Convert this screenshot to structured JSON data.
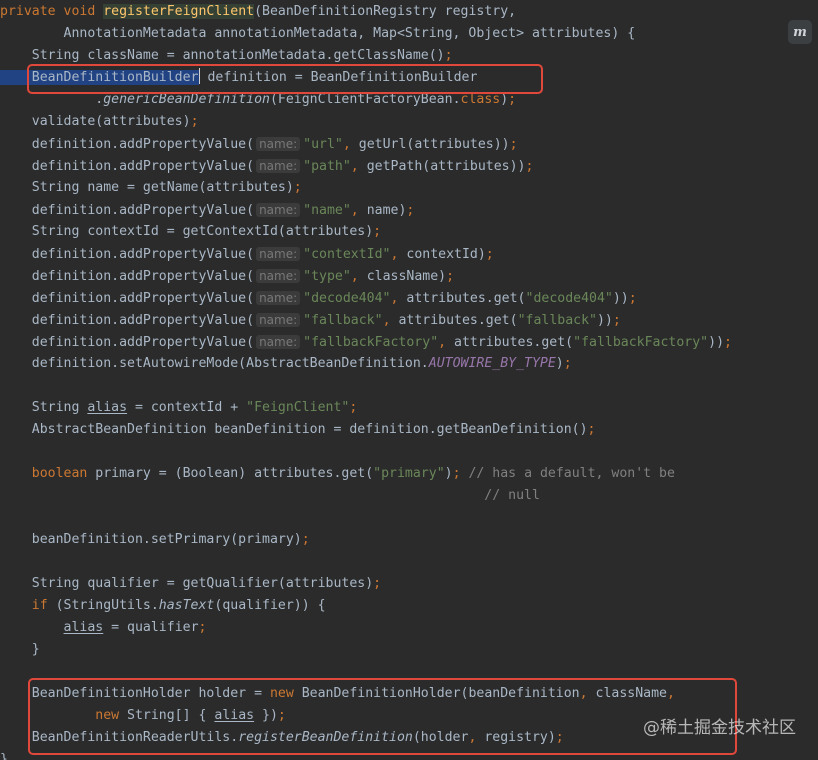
{
  "editor": {
    "plugin_badge": "m",
    "watermark": "@稀土掘金技术社区",
    "lines": [
      [
        [
          "kw",
          "private void "
        ],
        [
          "fnbg",
          "registerFeignClient"
        ],
        [
          "",
          "(BeanDefinitionRegistry registry,"
        ]
      ],
      [
        [
          "",
          "        AnnotationMetadata annotationMetadata, Map<String, Object> attributes) {"
        ]
      ],
      [
        [
          "",
          "    String className = annotationMetadata.getClassName()"
        ],
        [
          "kw",
          ";"
        ]
      ],
      [
        [
          "sel",
          "    BeanDefinitionBuilder"
        ],
        [
          "caret",
          ""
        ],
        [
          "sel",
          ""
        ],
        [
          "",
          " definition = BeanDefinitionBuilder"
        ]
      ],
      [
        [
          "",
          "            ."
        ],
        [
          "it",
          "genericBeanDefinition"
        ],
        [
          "",
          "(FeignClientFactoryBean."
        ],
        [
          "kw",
          "class"
        ],
        [
          "",
          ")"
        ],
        [
          "kw",
          ";"
        ]
      ],
      [
        [
          "",
          "    validate(attributes)"
        ],
        [
          "kw",
          ";"
        ]
      ],
      [
        [
          "",
          "    definition.addPropertyValue("
        ],
        [
          "hint",
          "name:"
        ],
        [
          "str",
          "\"url\""
        ],
        [
          "kw",
          ","
        ],
        [
          "",
          " getUrl(attributes))"
        ],
        [
          "kw",
          ";"
        ]
      ],
      [
        [
          "",
          "    definition.addPropertyValue("
        ],
        [
          "hint",
          "name:"
        ],
        [
          "str",
          "\"path\""
        ],
        [
          "kw",
          ","
        ],
        [
          "",
          " getPath(attributes))"
        ],
        [
          "kw",
          ";"
        ]
      ],
      [
        [
          "",
          "    String name = getName(attributes)"
        ],
        [
          "kw",
          ";"
        ]
      ],
      [
        [
          "",
          "    definition.addPropertyValue("
        ],
        [
          "hint",
          "name:"
        ],
        [
          "str",
          "\"name\""
        ],
        [
          "kw",
          ","
        ],
        [
          "",
          " name)"
        ],
        [
          "kw",
          ";"
        ]
      ],
      [
        [
          "",
          "    String contextId = getContextId(attributes)"
        ],
        [
          "kw",
          ";"
        ]
      ],
      [
        [
          "",
          "    definition.addPropertyValue("
        ],
        [
          "hint",
          "name:"
        ],
        [
          "str",
          "\"contextId\""
        ],
        [
          "kw",
          ","
        ],
        [
          "",
          " contextId)"
        ],
        [
          "kw",
          ";"
        ]
      ],
      [
        [
          "",
          "    definition.addPropertyValue("
        ],
        [
          "hint",
          "name:"
        ],
        [
          "str",
          "\"type\""
        ],
        [
          "kw",
          ","
        ],
        [
          "",
          " className)"
        ],
        [
          "kw",
          ";"
        ]
      ],
      [
        [
          "",
          "    definition.addPropertyValue("
        ],
        [
          "hint",
          "name:"
        ],
        [
          "str",
          "\"decode404\""
        ],
        [
          "kw",
          ","
        ],
        [
          "",
          " attributes.get("
        ],
        [
          "str",
          "\"decode404\""
        ],
        [
          "",
          "))"
        ],
        [
          "kw",
          ";"
        ]
      ],
      [
        [
          "",
          "    definition.addPropertyValue("
        ],
        [
          "hint",
          "name:"
        ],
        [
          "str",
          "\"fallback\""
        ],
        [
          "kw",
          ","
        ],
        [
          "",
          " attributes.get("
        ],
        [
          "str",
          "\"fallback\""
        ],
        [
          "",
          "))"
        ],
        [
          "kw",
          ";"
        ]
      ],
      [
        [
          "",
          "    definition.addPropertyValue("
        ],
        [
          "hint",
          "name:"
        ],
        [
          "str",
          "\"fallbackFactory\""
        ],
        [
          "kw",
          ","
        ],
        [
          "",
          " attributes.get("
        ],
        [
          "str",
          "\"fallbackFactory\""
        ],
        [
          "",
          "))"
        ],
        [
          "kw",
          ";"
        ]
      ],
      [
        [
          "",
          "    definition.setAutowireMode(AbstractBeanDefinition."
        ],
        [
          "const",
          "AUTOWIRE_BY_TYPE"
        ],
        [
          "",
          ")"
        ],
        [
          "kw",
          ";"
        ]
      ],
      [],
      [
        [
          "",
          "    String "
        ],
        [
          "ul",
          "alias"
        ],
        [
          "",
          " = contextId + "
        ],
        [
          "str",
          "\"FeignClient\""
        ],
        [
          "kw",
          ";"
        ]
      ],
      [
        [
          "",
          "    AbstractBeanDefinition beanDefinition = definition.getBeanDefinition()"
        ],
        [
          "kw",
          ";"
        ]
      ],
      [],
      [
        [
          "kw",
          "    boolean "
        ],
        [
          "",
          "primary = (Boolean) attributes.get("
        ],
        [
          "str",
          "\"primary\""
        ],
        [
          "",
          ")"
        ],
        [
          "kw",
          ";"
        ],
        [
          "cm",
          " // has a default, won't be"
        ]
      ],
      [
        [
          "cm",
          "                                                             // null"
        ]
      ],
      [],
      [
        [
          "",
          "    beanDefinition.setPrimary(primary)"
        ],
        [
          "kw",
          ";"
        ]
      ],
      [],
      [
        [
          "",
          "    String qualifier = getQualifier(attributes)"
        ],
        [
          "kw",
          ";"
        ]
      ],
      [
        [
          "kw",
          "    if "
        ],
        [
          "",
          "(StringUtils."
        ],
        [
          "it",
          "hasText"
        ],
        [
          "",
          "(qualifier)) {"
        ]
      ],
      [
        [
          "",
          "        "
        ],
        [
          "ul",
          "alias"
        ],
        [
          "",
          " = qualifier"
        ],
        [
          "kw",
          ";"
        ]
      ],
      [
        [
          "",
          "    }"
        ]
      ],
      [],
      [
        [
          "",
          "    BeanDefinitionHolder holder = "
        ],
        [
          "kw",
          "new "
        ],
        [
          "",
          "BeanDefinitionHolder(beanDefinition"
        ],
        [
          "kw",
          ","
        ],
        [
          "",
          " className"
        ],
        [
          "kw",
          ","
        ]
      ],
      [
        [
          "kw",
          "            new "
        ],
        [
          "",
          "String[] { "
        ],
        [
          "ul",
          "alias"
        ],
        [
          "",
          " })"
        ],
        [
          "kw",
          ";"
        ]
      ],
      [
        [
          "",
          "    BeanDefinitionReaderUtils."
        ],
        [
          "it",
          "registerBeanDefinition"
        ],
        [
          "",
          "(holder"
        ],
        [
          "kw",
          ","
        ],
        [
          "",
          " registry)"
        ],
        [
          "kw",
          ";"
        ]
      ],
      [
        [
          "",
          "}"
        ]
      ]
    ]
  }
}
